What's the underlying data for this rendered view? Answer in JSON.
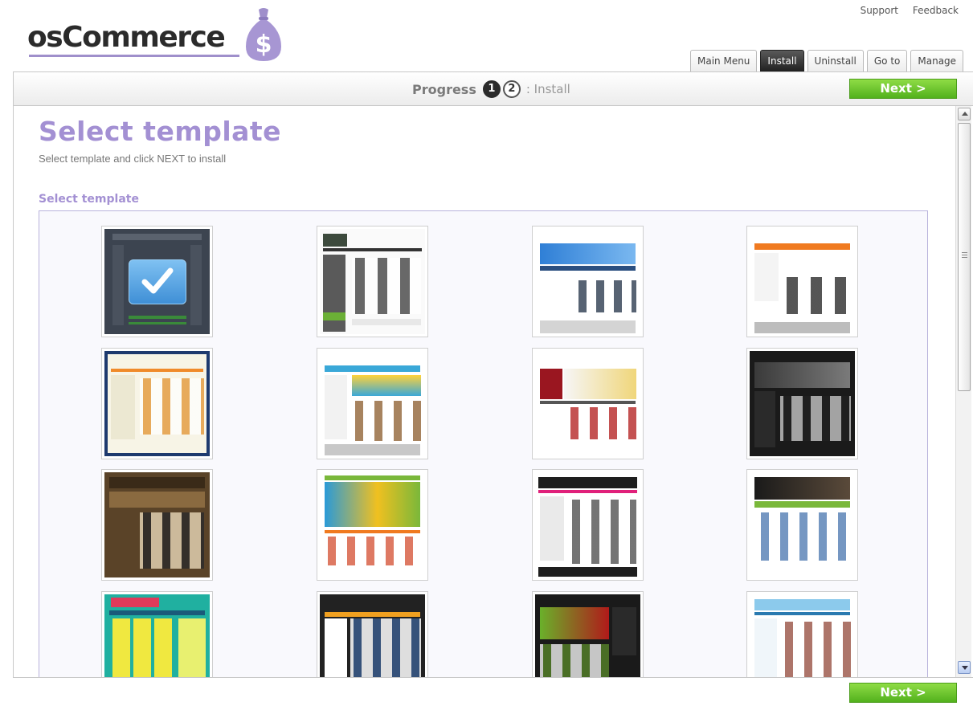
{
  "header": {
    "logo_text": "osCommerce",
    "links": [
      "Support",
      "Feedback"
    ],
    "tabs": [
      {
        "label": "Main Menu",
        "active": false
      },
      {
        "label": "Install",
        "active": true
      },
      {
        "label": "Uninstall",
        "active": false
      },
      {
        "label": "Go to",
        "active": false
      },
      {
        "label": "Manage",
        "active": false
      }
    ]
  },
  "progress": {
    "label": "Progress",
    "steps": [
      "1",
      "2"
    ],
    "current_step": 1,
    "step_name": ": Install",
    "next_label": "Next >"
  },
  "main": {
    "title": "Select template",
    "subtitle": "Select template and click NEXT to install",
    "section_label": "Select template",
    "templates": [
      {
        "id": "t1",
        "selected": true,
        "style": "selected"
      },
      {
        "id": "t2",
        "style": "laptops-shop"
      },
      {
        "id": "t3",
        "style": "eshop-blue"
      },
      {
        "id": "t4",
        "style": "store-orange"
      },
      {
        "id": "t5",
        "style": "navy-shop"
      },
      {
        "id": "t6",
        "style": "toys-store"
      },
      {
        "id": "t7",
        "style": "flowers-red"
      },
      {
        "id": "t8",
        "style": "tshirt-dark"
      },
      {
        "id": "t9",
        "style": "brown-tshirts"
      },
      {
        "id": "t10",
        "style": "toy-shop-colorful"
      },
      {
        "id": "t11",
        "style": "electronics-dark"
      },
      {
        "id": "t12",
        "style": "book-store"
      },
      {
        "id": "t13",
        "style": "online-store-green"
      },
      {
        "id": "t14",
        "style": "electronics-black"
      },
      {
        "id": "t15",
        "style": "flower-green"
      },
      {
        "id": "t16",
        "style": "light-blue-shop"
      }
    ]
  },
  "footer": {
    "next_label": "Next >"
  },
  "colors": {
    "accent": "#a390d3",
    "next_green": "#6cc52b",
    "active_tab": "#2b2b2b"
  }
}
